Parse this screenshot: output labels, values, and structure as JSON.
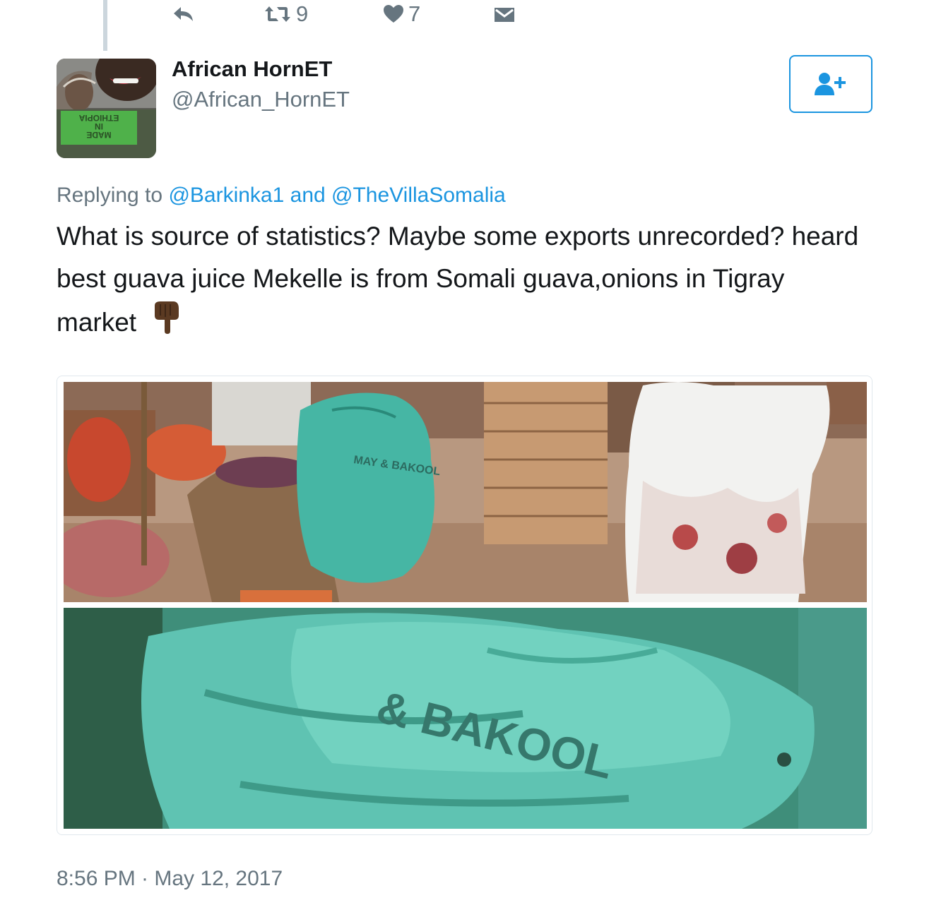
{
  "previous_tweet": {
    "actions": {
      "reply_icon": "reply-icon",
      "retweet_icon": "retweet-icon",
      "retweet_count": "9",
      "like_icon": "heart-icon",
      "like_count": "7",
      "dm_icon": "envelope-icon"
    }
  },
  "tweet": {
    "author": {
      "display_name": "African HornET",
      "handle": "@African_HornET",
      "avatar_text_lines": [
        "MADE",
        "IN",
        "ETHIOPIA"
      ]
    },
    "follow_button_icon": "add-user-icon",
    "reply_prefix": "Replying to ",
    "reply_mentions": [
      "@Barkinka1",
      "@TheVillaSomalia"
    ],
    "reply_joiner": " and ",
    "text": "What is source of statistics? Maybe some exports unrecorded? heard best guava juice Mekelle is from Somali guava,onions in Tigray market",
    "emoji": "backhand-index-pointing-down-icon",
    "media": {
      "top_photo": {
        "bag_text": "MAY & BAKOOL"
      },
      "bottom_photo": {
        "bag_text": "& BAKOOL"
      }
    },
    "timestamp": "8:56 PM · May 12, 2017"
  },
  "colors": {
    "link": "#1b95e0",
    "muted": "#66757f",
    "text": "#14171a",
    "border": "#e1e8ed"
  }
}
